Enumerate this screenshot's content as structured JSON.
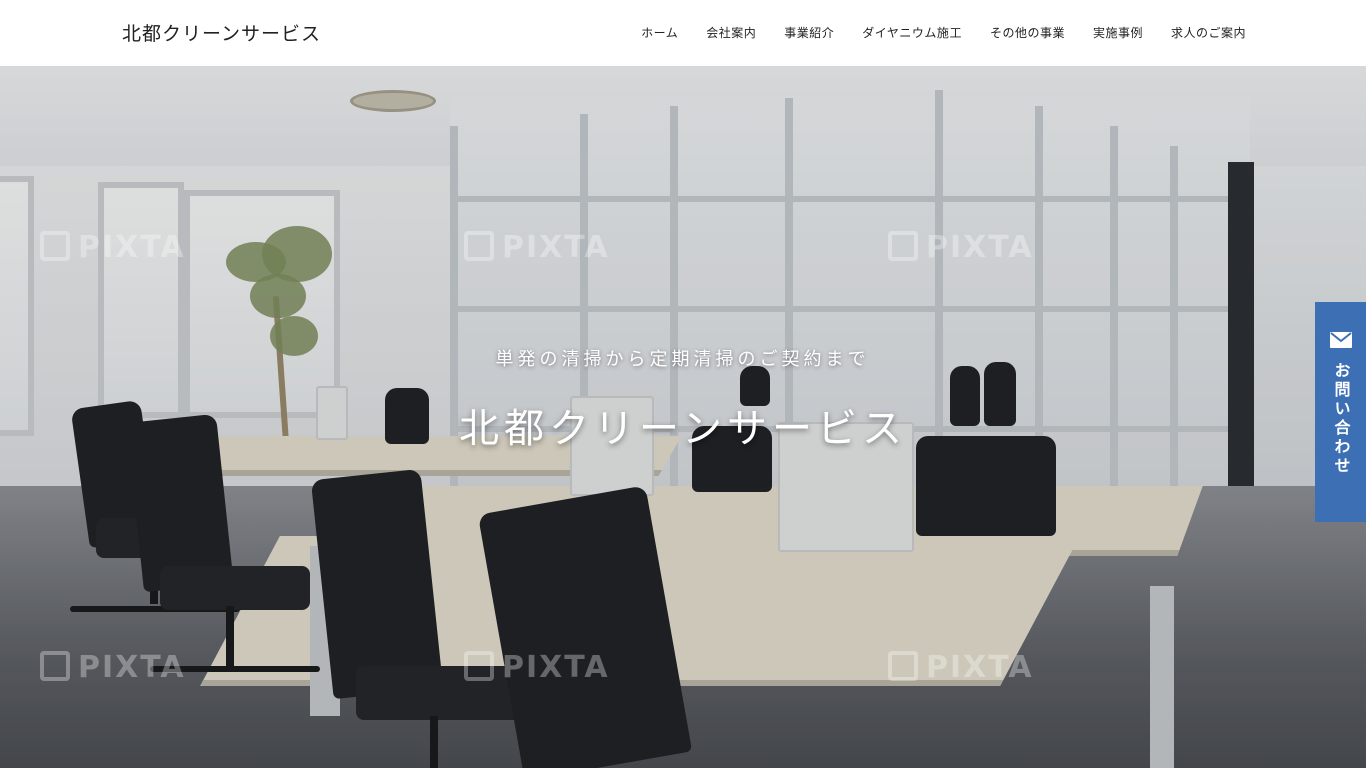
{
  "header": {
    "logo": "北都クリーンサービス",
    "nav": [
      {
        "label": "ホーム"
      },
      {
        "label": "会社案内"
      },
      {
        "label": "事業紹介"
      },
      {
        "label": "ダイヤニウム施工"
      },
      {
        "label": "その他の事業"
      },
      {
        "label": "実施事例"
      },
      {
        "label": "求人のご案内"
      }
    ]
  },
  "hero": {
    "subtitle": "単発の清掃から定期清掃のご契約まで",
    "title": "北都クリーンサービス",
    "image_description": "modern office interior with desks, black chairs and glass partitions",
    "watermark": "PIXTA"
  },
  "contact_tab": {
    "label": "お問い合わせ",
    "icon": "mail-icon",
    "color": "#3d6fb5"
  }
}
